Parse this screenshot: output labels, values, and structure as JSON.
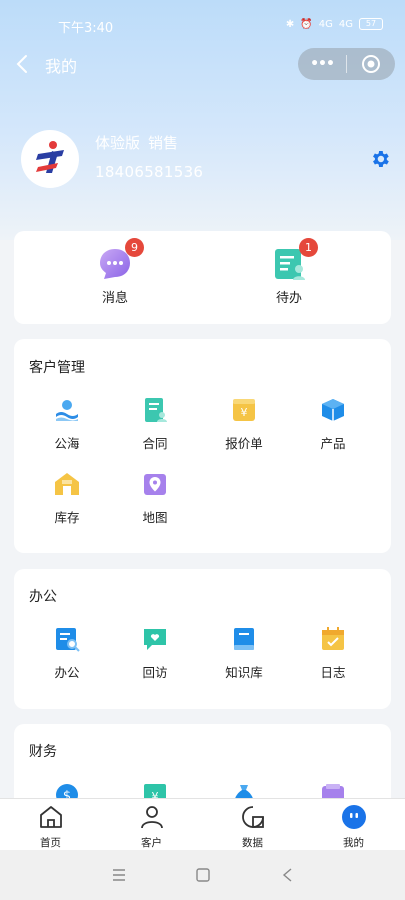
{
  "status": {
    "time": "下午3:40",
    "signal_a": "4G",
    "signal_b": "4G",
    "battery": "57"
  },
  "nav": {
    "title": "我的",
    "more": "•••"
  },
  "profile": {
    "version": "体验版",
    "role": "销售",
    "phone": "18406581536"
  },
  "top": {
    "items": [
      {
        "label": "消息",
        "badge": "9",
        "icon": "message-icon"
      },
      {
        "label": "待办",
        "badge": "1",
        "icon": "todo-icon"
      }
    ]
  },
  "customer": {
    "title": "客户管理",
    "items": [
      {
        "label": "公海",
        "icon": "sea-icon"
      },
      {
        "label": "合同",
        "icon": "contract-icon"
      },
      {
        "label": "报价单",
        "icon": "quote-icon"
      },
      {
        "label": "产品",
        "icon": "product-icon"
      },
      {
        "label": "库存",
        "icon": "inventory-icon"
      },
      {
        "label": "地图",
        "icon": "map-icon"
      }
    ]
  },
  "office": {
    "title": "办公",
    "items": [
      {
        "label": "办公",
        "icon": "office-icon"
      },
      {
        "label": "回访",
        "icon": "revisit-icon"
      },
      {
        "label": "知识库",
        "icon": "knowledge-icon"
      },
      {
        "label": "日志",
        "icon": "log-icon"
      }
    ]
  },
  "finance": {
    "title": "财务"
  },
  "tabbar": {
    "items": [
      {
        "label": "首页",
        "icon": "home-icon"
      },
      {
        "label": "客户",
        "icon": "customer-icon"
      },
      {
        "label": "数据",
        "icon": "data-icon"
      },
      {
        "label": "我的",
        "icon": "me-icon",
        "active": true
      }
    ]
  },
  "colors": {
    "accent": "#1a73e8",
    "badge": "#e5483b",
    "hero_top": "#bcdcf9"
  }
}
